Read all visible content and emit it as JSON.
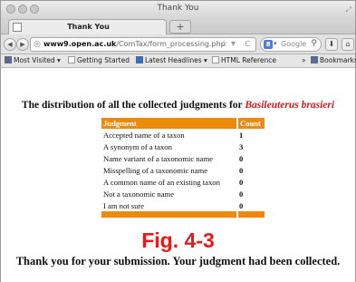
{
  "window": {
    "title": "Thank You"
  },
  "tabs": [
    {
      "label": "Thank You"
    }
  ],
  "new_tab": {
    "label": "+"
  },
  "nav": {
    "url_host": "www9.open.ac.uk",
    "url_path": "/ComTax/form_processing.php",
    "search_placeholder": "Google",
    "search_engine_glyph": "8",
    "back_icon": "back-arrow-icon",
    "forward_icon": "forward-arrow-icon"
  },
  "bookmarks": {
    "items": [
      {
        "label": "Most Visited ▾"
      },
      {
        "label": "Getting Started"
      },
      {
        "label": "Latest Headlines ▾"
      },
      {
        "label": "HTML Reference"
      }
    ],
    "overflow": "»",
    "bookmarks_menu": "Bookmarks ▾"
  },
  "page": {
    "heading_prefix": "The distribution of all the collected judgments for",
    "heading_species": "Basileuterus brasieri",
    "table": {
      "headers": [
        "Judgment",
        "Count"
      ],
      "rows": [
        {
          "judgment": "Accepted name of a taxon",
          "count": "1"
        },
        {
          "judgment": "A synonym of a taxon",
          "count": "3"
        },
        {
          "judgment": "Name variant of a taxonomic name",
          "count": "0"
        },
        {
          "judgment": "Misspelling of a taxonomic name",
          "count": "0"
        },
        {
          "judgment": "A common name of an existing taxon",
          "count": "0"
        },
        {
          "judgment": "Not a taxonomic name",
          "count": "0"
        },
        {
          "judgment": "I am not sure",
          "count": "0"
        }
      ]
    },
    "figure_label": "Fig. 4-3",
    "thanks_message": "Thank you for your submission. Your judgment had been collected."
  },
  "colors": {
    "table_header": "#ec8a0e",
    "species": "#d11a1a",
    "figure_label": "#e51b1b"
  }
}
